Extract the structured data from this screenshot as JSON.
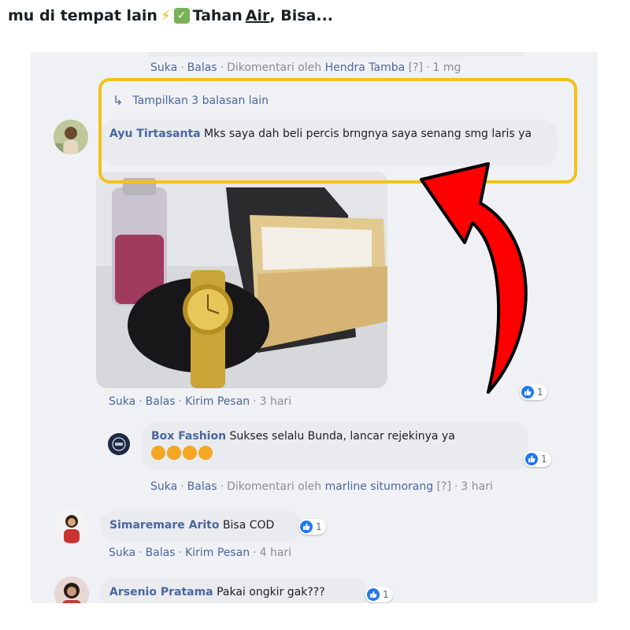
{
  "header": {
    "prefix": "mu di tempat lain",
    "after_check": "Tahan",
    "air_word": "Air",
    "suffix": ", Bisa..."
  },
  "top_meta": {
    "like": "Suka",
    "reply": "Balas",
    "commented_by": "Dikomentari oleh",
    "commenter": "Hendra Tamba",
    "flag": "[?]",
    "time": "1 mg"
  },
  "show_more_replies": "Tampilkan 3 balasan lain",
  "comments": [
    {
      "author": "Ayu Tirtasanta",
      "text": "Mks saya dah beli percis brngnya saya senang smg laris ya",
      "actions": {
        "like": "Suka",
        "reply": "Balas",
        "send": "Kirim Pesan",
        "time": "3 hari"
      },
      "reaction_count": "1"
    },
    {
      "author": "Box Fashion",
      "text": "Sukses selalu Bunda, lancar rejekinya ya",
      "actions": {
        "like": "Suka",
        "reply": "Balas",
        "commented_by": "Dikomentari oleh",
        "commenter": "marline situmorang",
        "flag": "[?]",
        "time": "3 hari"
      },
      "reaction_count": "1"
    },
    {
      "author": "Simaremare Arito",
      "text": "Bisa COD",
      "actions": {
        "like": "Suka",
        "reply": "Balas",
        "send": "Kirim Pesan",
        "time": "4 hari"
      },
      "reaction_count": "1"
    },
    {
      "author": "Arsenio Pratama",
      "text": "Pakai ongkir gak???",
      "reaction_count": "1"
    }
  ],
  "colors": {
    "link_blue": "#4b67a1",
    "like_blue": "#2078f4",
    "highlight_yellow": "#f3c21b",
    "arrow_red": "#ff0000",
    "panel_bg": "#f0f1f4",
    "bubble_bg": "#e9ebee"
  }
}
